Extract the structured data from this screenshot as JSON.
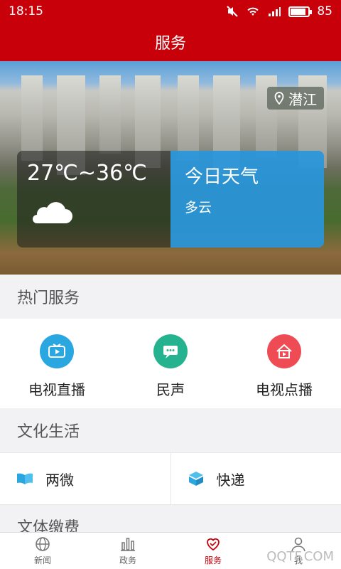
{
  "status_bar": {
    "time": "18:15",
    "battery_level": "85",
    "battery_fraction": 0.85
  },
  "header": {
    "title": "服务"
  },
  "hero": {
    "location": "潜江",
    "temperature_range": "27℃~36℃",
    "weather_card_title": "今日天气",
    "weather_condition": "多云"
  },
  "hot_services": {
    "heading": "热门服务",
    "items": [
      {
        "label": "电视直播",
        "icon": "tv-play-icon",
        "color": "#2aa7e0"
      },
      {
        "label": "民声",
        "icon": "chat-bubble-icon",
        "color": "#25b38f"
      },
      {
        "label": "电视点播",
        "icon": "house-vod-icon",
        "color": "#ef4b55"
      }
    ]
  },
  "culture": {
    "heading": "文化生活",
    "items": [
      {
        "label": "两微",
        "icon": "book-icon",
        "color": "#2aa7e0"
      },
      {
        "label": "快递",
        "icon": "package-box-icon",
        "color": "#2aa7e0"
      }
    ]
  },
  "next_section_heading_partial": "文体缴费",
  "tabbar": {
    "items": [
      {
        "label": "新闻",
        "icon": "globe-icon"
      },
      {
        "label": "政务",
        "icon": "bar-chart-icon"
      },
      {
        "label": "服务",
        "icon": "heart-icon",
        "active": true
      },
      {
        "label": "我",
        "icon": "user-icon"
      }
    ]
  },
  "watermark": "QQTF.COM",
  "colors": {
    "brand_red": "#c8000a",
    "weather_blue": "#2896dc"
  }
}
